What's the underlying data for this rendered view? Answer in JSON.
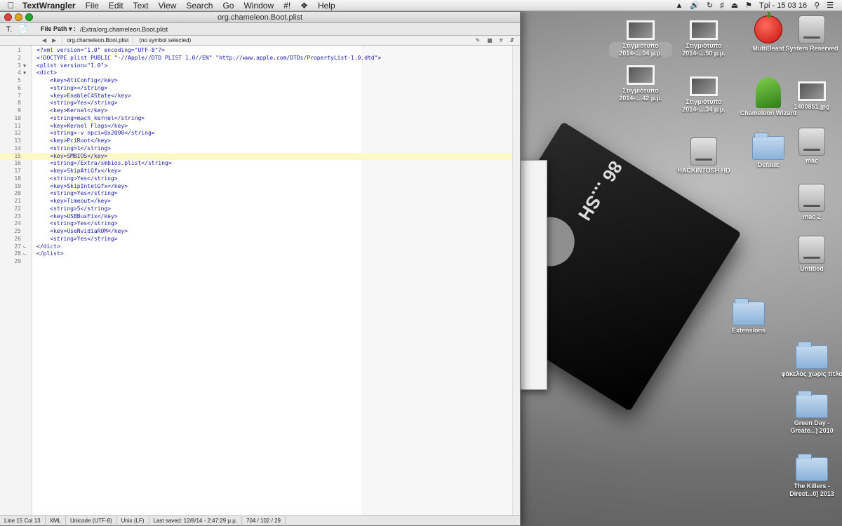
{
  "menubar": {
    "app_name": "TextWrangler",
    "items": [
      "File",
      "Edit",
      "Text",
      "View",
      "Search",
      "Go",
      "Window",
      "#!",
      "Help"
    ],
    "clock": "Τρί - 15 03 16"
  },
  "window": {
    "title": "org.chameleon.Boot.plist",
    "file_path_label": "File Path ▾ :",
    "file_path": "/Extra/org.chameleon.Boot.plist",
    "nav_file": "org.chameleon.Boot.plist",
    "symbol": "(no symbol selected)"
  },
  "code_lines": [
    "<?xml version=\"1.0\" encoding=\"UTF-8\"?>",
    "<!DOCTYPE plist PUBLIC \"-//Apple//DTD PLIST 1.0//EN\" \"http://www.apple.com/DTDs/PropertyList-1.0.dtd\">",
    "<plist version=\"1.0\">",
    "<dict>",
    "    <key>AtiConfig</key>",
    "    <string></string>",
    "    <key>EnableC4State</key>",
    "    <string>Yes</string>",
    "    <key>Kernel</key>",
    "    <string>mach_kernel</string>",
    "    <key>Kernel Flags</key>",
    "    <string>-v npci=0x2000</string>",
    "    <key>PciRoot</key>",
    "    <string>1</string>",
    "    <key>SMBIOS</key>",
    "    <string>/Extra/smbios.plist</string>",
    "    <key>SkipAtiGfx</key>",
    "    <string>Yes</string>",
    "    <key>SkipIntelGfx</key>",
    "    <string>Yes</string>",
    "    <key>Timeout</key>",
    "    <string>5</string>",
    "    <key>USBBusFix</key>",
    "    <string>Yes</string>",
    "    <key>UseNvidiaROM</key>",
    "    <string>Yes</string>",
    "</dict>",
    "</plist>",
    ""
  ],
  "current_line": 15,
  "statusbar": {
    "position": "Line 15 Col 13",
    "language": "XML",
    "encoding": "Unicode (UTF-8)",
    "line_endings": "Unix (LF)",
    "last_saved": "Last saved: 12/8/14 - 2:47:29 μ.μ.",
    "counts": "704 / 102 / 29"
  },
  "desktop_icons": [
    {
      "label": "Στιγμιότυπο 2014-....04 μ.μ.",
      "kind": "shot"
    },
    {
      "label": "Στιγμιότυπο 2014-....50 μ.μ.",
      "kind": "shot"
    },
    {
      "label": "MultiBeast",
      "kind": "apple"
    },
    {
      "label": "System Reserved",
      "kind": "hdd"
    },
    {
      "label": "Στιγμιότυπο 2014-....42 μ.μ.",
      "kind": "shot"
    },
    {
      "label": "Στιγμιότυπο 2014-....34 μ.μ.",
      "kind": "shot"
    },
    {
      "label": "Chameleon Wizard",
      "kind": "wizard"
    },
    {
      "label": "1400851.jpg",
      "kind": "shot"
    },
    {
      "label": "HACKINTOSH HD",
      "kind": "hdd"
    },
    {
      "label": "Default",
      "kind": "folder"
    },
    {
      "label": "mac",
      "kind": "hdd"
    },
    {
      "label": "mac 2",
      "kind": "hdd"
    },
    {
      "label": "Untitled",
      "kind": "hdd"
    },
    {
      "label": "Extensions",
      "kind": "folder"
    },
    {
      "label": "φάκελος χωρίς τίτλο",
      "kind": "folder"
    },
    {
      "label": "Green Day - Greate...) 2010",
      "kind": "folder"
    },
    {
      "label": "The Killers - Direct...0] 2013",
      "kind": "folder"
    }
  ],
  "wallpaper_text": "86 ...SH"
}
